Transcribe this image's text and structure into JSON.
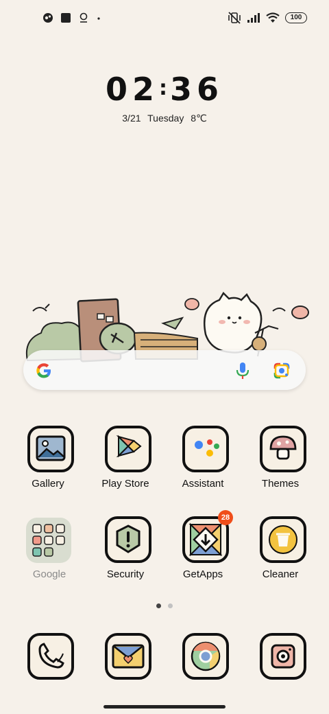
{
  "status_bar": {
    "left_icons": [
      "incognito-icon",
      "square-notification-icon",
      "location-pin-icon",
      "dot-icon"
    ],
    "right_icons": [
      "vibrate-off-icon",
      "signal-bars-icon",
      "wifi-icon"
    ],
    "battery": "100"
  },
  "clock": {
    "hours": "02",
    "separator": ":",
    "minutes": "36"
  },
  "date_weather": "3/21  Tuesday  8℃",
  "search": {
    "icons": [
      "google-g-icon",
      "microphone-icon",
      "google-lens-icon"
    ]
  },
  "apps": [
    {
      "label": "Gallery",
      "icon": "gallery-icon"
    },
    {
      "label": "Play Store",
      "icon": "play-store-icon"
    },
    {
      "label": "Assistant",
      "icon": "assistant-icon"
    },
    {
      "label": "Themes",
      "icon": "themes-icon"
    },
    {
      "label": "Google",
      "icon": "google-folder-icon"
    },
    {
      "label": "Security",
      "icon": "security-icon"
    },
    {
      "label": "GetApps",
      "icon": "getapps-icon",
      "badge": "28"
    },
    {
      "label": "Cleaner",
      "icon": "cleaner-icon"
    }
  ],
  "dock": [
    {
      "icon": "phone-icon"
    },
    {
      "icon": "messages-icon"
    },
    {
      "icon": "chrome-icon"
    },
    {
      "icon": "camera-icon"
    }
  ],
  "page_indicator": {
    "pages": 2,
    "active": 1
  },
  "colors": {
    "background": "#f6f1ea",
    "badge": "#f04e1a",
    "folder_label": "#8a8a8a"
  }
}
